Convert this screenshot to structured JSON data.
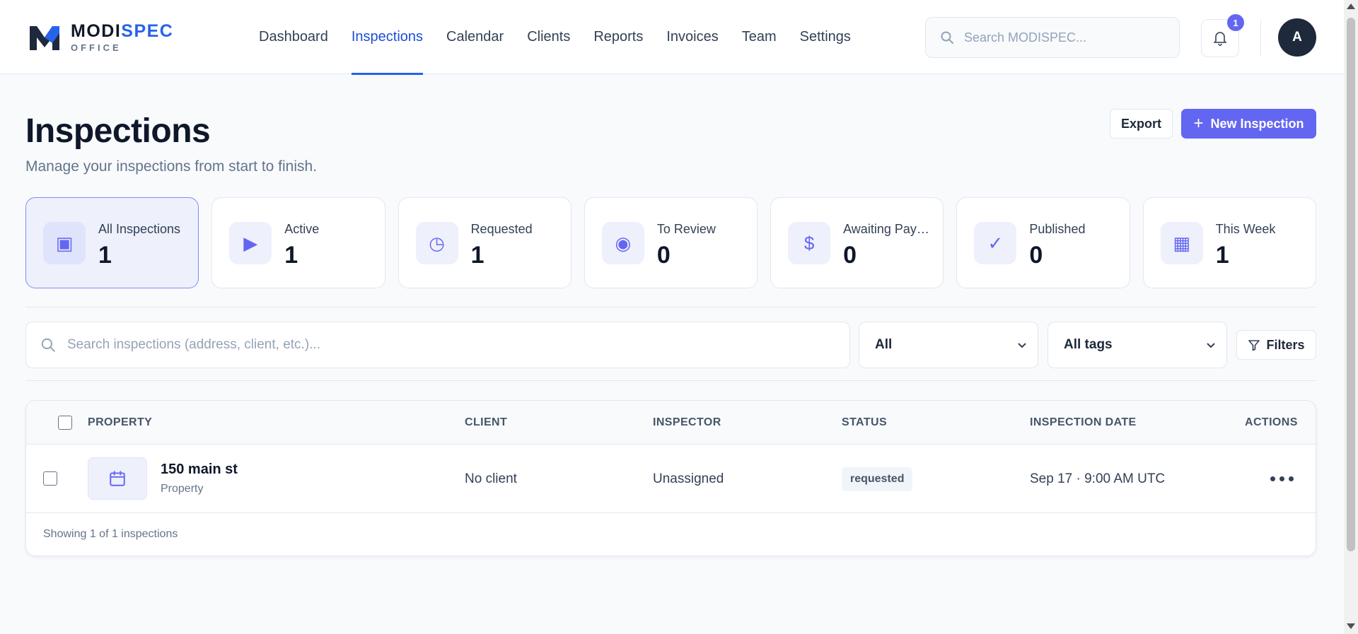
{
  "brand": {
    "name_part1": "MODI",
    "name_part2": "SPEC",
    "subtitle": "OFFICE",
    "colors": {
      "primary": "#6366f1",
      "link": "#2563eb",
      "dark": "#1e293b"
    }
  },
  "nav": {
    "items": [
      {
        "label": "Dashboard",
        "active": false
      },
      {
        "label": "Inspections",
        "active": true
      },
      {
        "label": "Calendar",
        "active": false
      },
      {
        "label": "Clients",
        "active": false
      },
      {
        "label": "Reports",
        "active": false
      },
      {
        "label": "Invoices",
        "active": false
      },
      {
        "label": "Team",
        "active": false
      },
      {
        "label": "Settings",
        "active": false
      }
    ]
  },
  "header": {
    "search_placeholder": "Search MODISPEC...",
    "notification_count": "1",
    "avatar_initial": "A"
  },
  "page": {
    "title": "Inspections",
    "subtitle": "Manage your inspections from start to finish.",
    "export_label": "Export",
    "new_label": "New Inspection",
    "new_icon": "+"
  },
  "stats": [
    {
      "label": "All Inspections",
      "value": "1",
      "icon": "square-icon",
      "glyph": "▣",
      "active": true
    },
    {
      "label": "Active",
      "value": "1",
      "icon": "play-icon",
      "glyph": "▶",
      "active": false
    },
    {
      "label": "Requested",
      "value": "1",
      "icon": "clock-icon",
      "glyph": "◷",
      "active": false
    },
    {
      "label": "To Review",
      "value": "0",
      "icon": "target-icon",
      "glyph": "◉",
      "active": false
    },
    {
      "label": "Awaiting Payment",
      "value": "0",
      "icon": "dollar-icon",
      "glyph": "$",
      "active": false
    },
    {
      "label": "Published",
      "value": "0",
      "icon": "check-icon",
      "glyph": "✓",
      "active": false
    },
    {
      "label": "This Week",
      "value": "1",
      "icon": "grid-icon",
      "glyph": "▦",
      "active": false
    }
  ],
  "filters": {
    "search_placeholder": "Search inspections (address, client, etc.)...",
    "status_select": "All",
    "tags_select": "All tags",
    "filters_label": "Filters"
  },
  "table": {
    "columns": [
      "PROPERTY",
      "CLIENT",
      "INSPECTOR",
      "STATUS",
      "INSPECTION DATE",
      "ACTIONS"
    ],
    "rows": [
      {
        "property": "150 main st",
        "property_type": "Property",
        "client": "No client",
        "inspector": "Unassigned",
        "status": "requested",
        "date": "Sep 17 · 9:00 AM UTC"
      }
    ],
    "footer": "Showing 1 of 1 inspections"
  }
}
